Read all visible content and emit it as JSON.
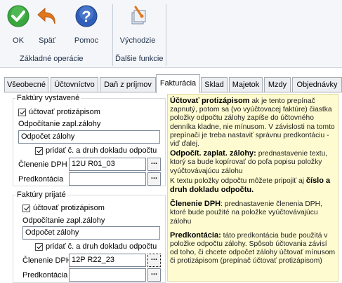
{
  "ribbon": {
    "ok_label": "OK",
    "back_label": "Späť",
    "help_label": "Pomoc",
    "defaults_label": "Východzie",
    "group_basic": "Základné operácie",
    "group_more": "Ďalšie funkcie"
  },
  "tabs": [
    "Všeobecné",
    "Účtovníctvo",
    "Daň z príjmov",
    "Fakturácia",
    "Sklad",
    "Majetok",
    "Mzdy",
    "Objednávky"
  ],
  "active_tab": "Fakturácia",
  "issued": {
    "legend": "Faktúry vystavené",
    "checkbox_label": "účtovať protizápisom",
    "advance_label": "Odpočítanie zapl.zálohy",
    "advance_value": "Odpočet zálohy",
    "add_doc_label": "pridať č. a druh dokladu odpočtu",
    "dph_label": "Členenie DPH",
    "dph_value": "12U R01_03",
    "precont_label": "Predkontácia",
    "precont_value": ""
  },
  "received": {
    "legend": "Faktúry prijaté",
    "checkbox_label": "účtovať protizápisom",
    "advance_label": "Odpočítanie zapl.zálohy",
    "advance_value": "Odpočet zálohy",
    "add_doc_label": "pridať č. a druh dokladu odpočtu",
    "dph_label": "Členenie DPH",
    "dph_value": "12P R22_23",
    "precont_label": "Predkontácia",
    "precont_value": ""
  },
  "browse_label": "...",
  "help": {
    "p1_title": "Účtovať protizápisom",
    "p1_text": " ak je tento prepínač zapnutý, potom sa (vo vyúčtovacej faktúre) čiastka položky odpočtu zálohy zapíše do účtovného denníka kladne, nie mínusom. V závislosti na tomto prepínači je treba nastaviť správnu predkontáciu - viď ďalej.",
    "p2_title": "Odpočít. zaplat. zálohy:",
    "p2_text": " prednastavenie textu, ktorý sa bude kopírovať do poľa popisu položky vyúčtovávajúcu zálohu",
    "p3_text": "K textu položky odpočtu môžete pripojiť aj ",
    "p3_bold": "číslo a druh dokladu odpočtu.",
    "p4_title": "Členenie DPH",
    "p4_text": ": prednastavenie členenia DPH, ktoré bude použité na položke vyúčtovávajúcu zálohu",
    "p5_title": "Predkontácia:",
    "p5_text": " táto predkontácia bude použitá v položke odpočtu zálohy. Spôsob účtovania závisí od toho, či chcete odpočet zálohy účtovať mínusom či protizápisom (prepínač účtovať protizápisom)"
  },
  "colors": {
    "ok_green": "#3aa640",
    "help_blue": "#2f5fb8",
    "back_orange": "#e0771f",
    "help_bg": "#fefbd0"
  }
}
